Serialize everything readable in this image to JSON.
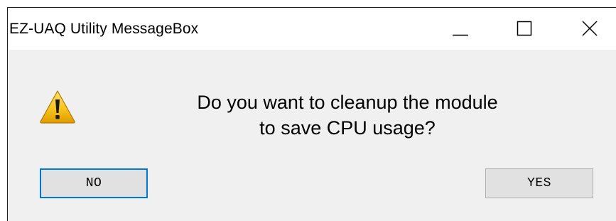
{
  "window": {
    "title": "EZ-UAQ Utility MessageBox"
  },
  "caption_buttons": {
    "minimize_icon": "minimize-icon",
    "maximize_icon": "maximize-icon",
    "close_icon": "close-icon"
  },
  "dialog": {
    "icon": "warning-icon",
    "message_line1": "Do you want to cleanup the module",
    "message_line2": "to save CPU usage?",
    "no_label": "NO",
    "yes_label": "YES"
  },
  "colors": {
    "focus_border": "#0078d7",
    "dialog_background": "#f0f0f0",
    "button_face": "#e1e1e1",
    "warning_yellow": "#f6c21a"
  }
}
